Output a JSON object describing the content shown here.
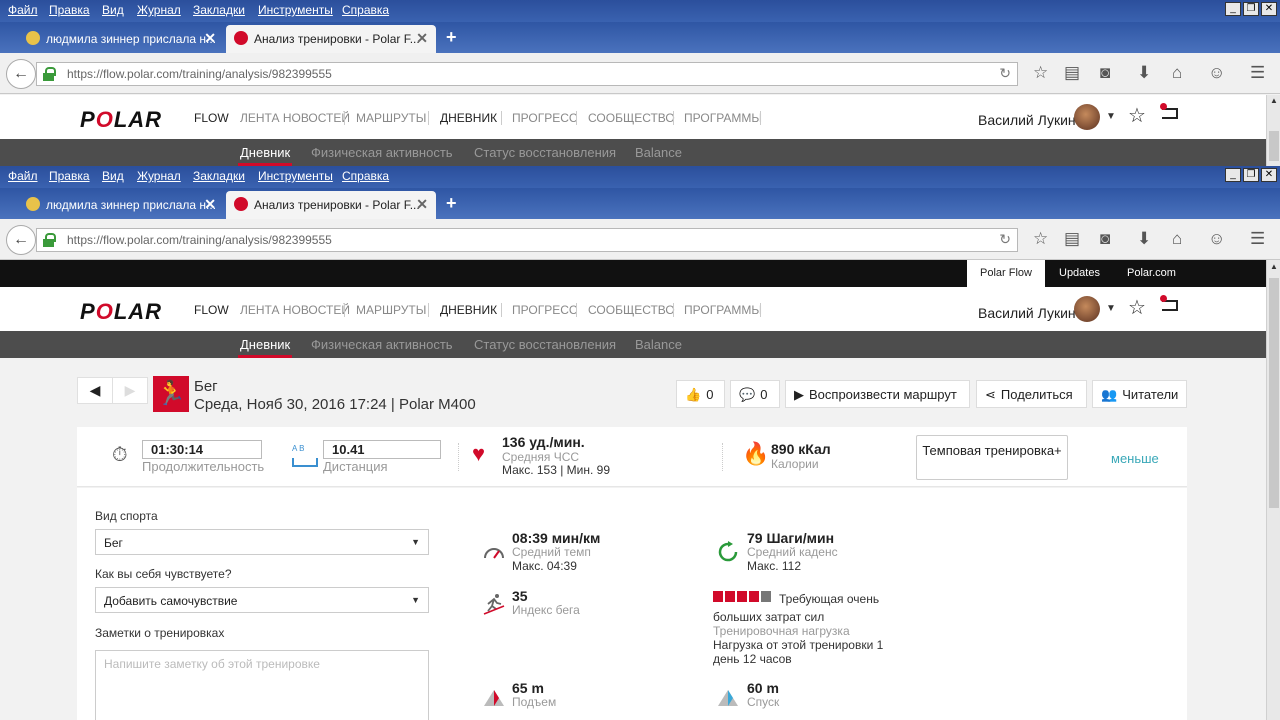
{
  "browser": {
    "menu": [
      "Файл",
      "Правка",
      "Вид",
      "Журнал",
      "Закладки",
      "Инструменты",
      "Справка"
    ],
    "tabs": [
      {
        "label": "людмила зиннер прислала н..."
      },
      {
        "label": "Анализ тренировки - Polar F..."
      }
    ],
    "url": "https://flow.polar.com/training/analysis/982399555"
  },
  "site": {
    "logo": "POLAR",
    "flow": "FLOW",
    "nav": [
      "ЛЕНТА НОВОСТЕЙ",
      "МАРШРУТЫ",
      "ДНЕВНИК",
      "ПРОГРЕСС",
      "СООБЩЕСТВО",
      "ПРОГРАММЫ"
    ],
    "user": "Василий Лукин",
    "subnav": [
      "Дневник",
      "Физическая активность",
      "Статус восстановления",
      "Balance"
    ],
    "topbar": [
      "Polar Flow",
      "Updates",
      "Polar.com"
    ]
  },
  "training": {
    "sport": "Бег",
    "date": "Среда, Нояб 30, 2016 17:24 | Polar M400",
    "likes": "0",
    "comments": "0",
    "replay": "Воспроизвести маршрут",
    "share": "Поделиться",
    "readers": "Читатели"
  },
  "summary": {
    "duration_value": "01:30:14",
    "duration_label": "Продолжительность",
    "distance_ab": "A   B",
    "distance_value": "10.41",
    "distance_label": "Дистанция",
    "hr_value": "136 уд./мин.",
    "hr_label": "Средняя ЧСС",
    "hr_minmax": "Макс. 153  |  Мин. 99",
    "cal_value": "890 кКал",
    "cal_label": "Калории",
    "tempo_button": "Темповая тренировка+",
    "less_link": "меньше"
  },
  "form": {
    "sport_label": "Вид спорта",
    "sport_value": "Бег",
    "feeling_label": "Как вы себя чувствуете?",
    "feeling_value": "Добавить самочувствие",
    "notes_label": "Заметки о тренировках",
    "notes_placeholder": "Напишите заметку об этой тренировке"
  },
  "stats": {
    "pace_value": "08:39 мин/км",
    "pace_label": "Средний темп",
    "pace_max": "Макс. 04:39",
    "cadence_value": "79 Шаги/мин",
    "cadence_label": "Средний каденс",
    "cadence_max": "Макс. 112",
    "running_index_value": "35",
    "running_index_label": "Индекс бега",
    "load_level": 4,
    "load_levels_total": 5,
    "load_text": "Требующая очень больших затрат сил",
    "load_label": "Тренировочная нагрузка",
    "load_detail": "Нагрузка от этой тренировки 1 день 12 часов",
    "ascent_value": "65 m",
    "ascent_label": "Подъем",
    "descent_value": "60 m",
    "descent_label": "Спуск"
  },
  "colors": {
    "brand_red": "#d10a2a",
    "link_teal": "#3aa8b8",
    "subnav_bg": "#4d4d4d"
  }
}
